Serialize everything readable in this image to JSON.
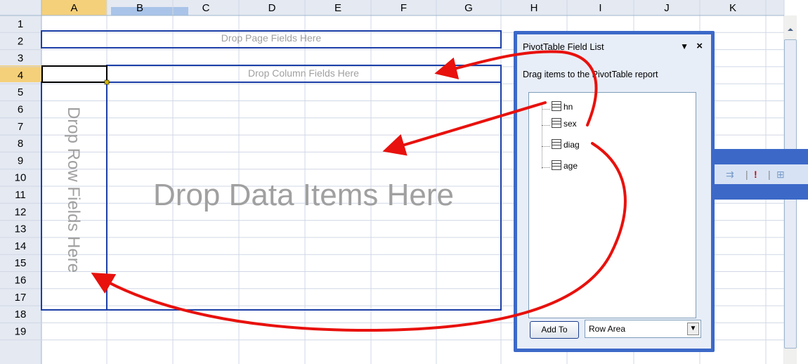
{
  "columns": [
    "A",
    "B",
    "C",
    "D",
    "E",
    "F",
    "G",
    "H",
    "I",
    "J",
    "K"
  ],
  "rows": [
    "1",
    "2",
    "3",
    "4",
    "5",
    "6",
    "7",
    "8",
    "9",
    "10",
    "11",
    "12",
    "13",
    "14",
    "15",
    "16",
    "17",
    "18",
    "19"
  ],
  "pivot": {
    "page_hint": "Drop Page Fields Here",
    "column_hint": "Drop Column Fields Here",
    "row_hint": "Drop Row Fields Here",
    "data_hint": "Drop Data Items Here"
  },
  "field_list": {
    "title": "PivotTable Field List",
    "instruction": "Drag items to the PivotTable report",
    "fields": [
      "hn",
      "sex",
      "diag",
      "age"
    ],
    "add_to_label": "Add To",
    "area_value": "Row Area"
  },
  "colors": {
    "pivot_border": "#1b3fa7",
    "arrow": "#e8110d",
    "panel": "#3c69c8",
    "selected_header": "#f5d07a"
  }
}
